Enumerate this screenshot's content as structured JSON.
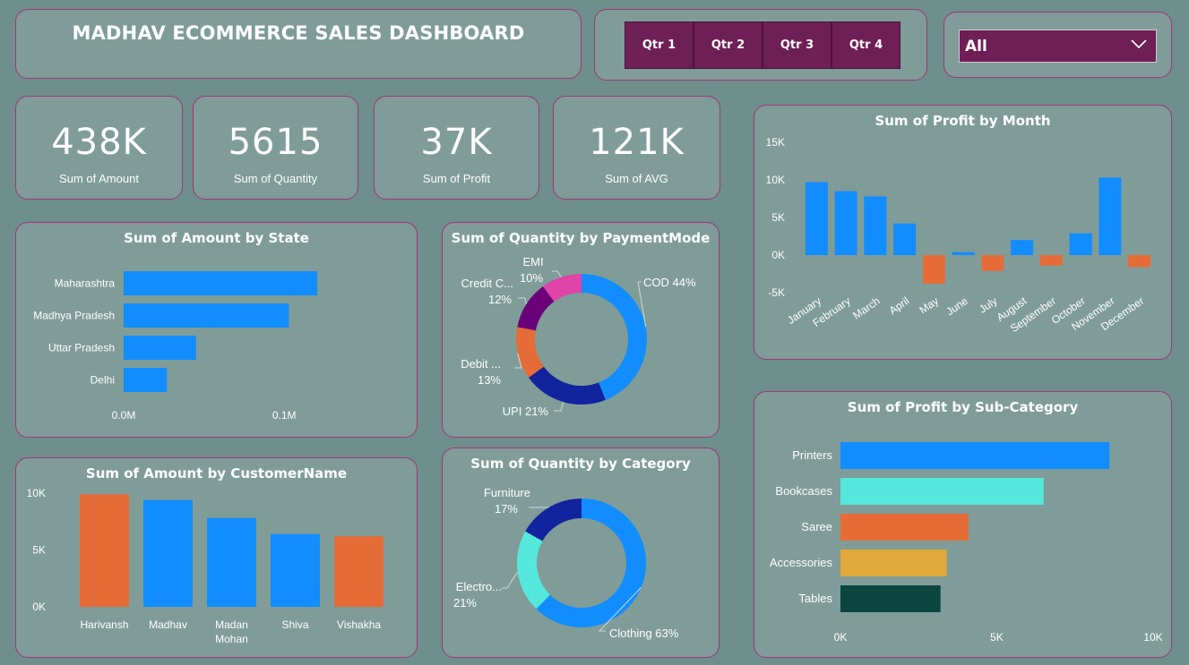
{
  "header": {
    "title": "MADHAV ECOMMERCE SALES DASHBOARD"
  },
  "quarters": [
    {
      "label": "Qtr 1"
    },
    {
      "label": "Qtr 2"
    },
    {
      "label": "Qtr 3"
    },
    {
      "label": "Qtr 4"
    }
  ],
  "filter": {
    "selected": "All"
  },
  "kpis": [
    {
      "value": "438K",
      "label": "Sum of Amount"
    },
    {
      "value": "5615",
      "label": "Sum of Quantity"
    },
    {
      "value": "37K",
      "label": "Sum of Profit"
    },
    {
      "value": "121K",
      "label": "Sum of AVG"
    }
  ],
  "colors": {
    "blue": "#118dff",
    "orange": "#e66c37",
    "navy": "#12239e",
    "purple": "#6b007b",
    "pink": "#e044a7",
    "cyan": "#55e8dc",
    "gold": "#e1a83a",
    "darkgreen": "#0c4540",
    "panel_border": "#a2357a",
    "button": "#6e1f55"
  },
  "chart_data": [
    {
      "id": "amount_by_state",
      "type": "bar",
      "orientation": "horizontal",
      "title": "Sum of Amount by State",
      "categories": [
        "Maharashtra",
        "Madhya Pradesh",
        "Uttar Pradesh",
        "Delhi"
      ],
      "values": [
        0.1205,
        0.1029,
        0.0451,
        0.0269
      ],
      "xlim": [
        0,
        0.13
      ],
      "xticks": [
        0,
        0.1
      ],
      "xtick_labels": [
        "0.0M",
        "0.1M"
      ]
    },
    {
      "id": "quantity_by_payment",
      "type": "pie",
      "donut": true,
      "title": "Sum of Quantity by PaymentMode",
      "slices": [
        {
          "name": "COD",
          "label": "COD 44%",
          "value": 44
        },
        {
          "name": "UPI",
          "label": "UPI 21%",
          "value": 21
        },
        {
          "name": "Debit ...",
          "label_line1": "Debit ...",
          "label_line2": "13%",
          "value": 13
        },
        {
          "name": "Credit C...",
          "label_line1": "Credit C...",
          "label_line2": "12%",
          "value": 12
        },
        {
          "name": "EMI",
          "label_line1": "EMI",
          "label_line2": "10%",
          "value": 10
        }
      ]
    },
    {
      "id": "profit_by_month",
      "type": "bar",
      "title": "Sum of Profit by Month",
      "categories": [
        "January",
        "February",
        "March",
        "April",
        "May",
        "June",
        "July",
        "August",
        "September",
        "October",
        "November",
        "December"
      ],
      "values": [
        9700,
        8500,
        7800,
        4200,
        -3800,
        400,
        -2100,
        2000,
        -1400,
        2900,
        10300,
        -1600
      ],
      "ylim": [
        -5000,
        15000
      ],
      "yticks": [
        -5000,
        0,
        5000,
        10000,
        15000
      ],
      "ytick_labels": [
        "-5K",
        "0K",
        "5K",
        "10K",
        "15K"
      ]
    },
    {
      "id": "amount_by_customer",
      "type": "bar",
      "title": "Sum of Amount by CustomerName",
      "categories": [
        "Harivansh",
        "Madhav",
        "Madan Mohan",
        "Shiva",
        "Vishakha"
      ],
      "values": [
        9900,
        9400,
        7800,
        6400,
        6200
      ],
      "ylim": [
        0,
        10000
      ],
      "yticks": [
        0,
        5000,
        10000
      ],
      "ytick_labels": [
        "0K",
        "5K",
        "10K"
      ]
    },
    {
      "id": "quantity_by_category",
      "type": "pie",
      "donut": true,
      "title": "Sum of Quantity by Category",
      "slices": [
        {
          "name": "Clothing",
          "label": "Clothing 63%",
          "value": 63
        },
        {
          "name": "Electro...",
          "label_line1": "Electro...",
          "label_line2": "21%",
          "value": 21
        },
        {
          "name": "Furniture",
          "label_line1": "Furniture",
          "label_line2": "17%",
          "value": 17
        }
      ]
    },
    {
      "id": "profit_by_subcategory",
      "type": "bar",
      "orientation": "horizontal",
      "title": "Sum of Profit by Sub-Category",
      "categories": [
        "Printers",
        "Bookcases",
        "Saree",
        "Accessories",
        "Tables"
      ],
      "values": [
        8600,
        6500,
        4100,
        3400,
        3200
      ],
      "xlim": [
        0,
        10000
      ],
      "xticks": [
        0,
        5000,
        10000
      ],
      "xtick_labels": [
        "0K",
        "5K",
        "10K"
      ]
    }
  ]
}
